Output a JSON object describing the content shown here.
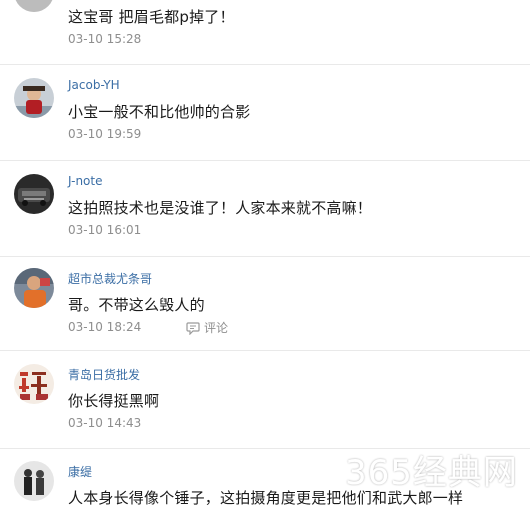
{
  "comments": [
    {
      "username": "",
      "text": "这宝哥 把眉毛都p掉了！",
      "time": "03-10 15:28"
    },
    {
      "username": "Jacob-YH",
      "text": "小宝一般不和比他帅的合影",
      "time": "03-10 19:59",
      "avatar_icon": "person-photo-avatar"
    },
    {
      "username": "J-note",
      "text": "这拍照技术也是没谁了！人家本来就不高嘛！",
      "time": "03-10 16:01",
      "avatar_icon": "car-photo-avatar"
    },
    {
      "username": "超市总裁尤条哥",
      "text": "哥。不带这么毁人的",
      "time": "03-10 18:24",
      "action_label": "评论",
      "avatar_icon": "person-orange-avatar"
    },
    {
      "username": "青岛日货批发",
      "text": "你长得挺黑啊",
      "time": "03-10 14:43",
      "avatar_icon": "calligraphy-avatar"
    },
    {
      "username": "康缇",
      "text": "人本身长得像个锤子，这拍摄角度更是把他们和武大郎一样",
      "time": "",
      "avatar_icon": "couple-photo-avatar"
    }
  ],
  "watermark": "365经典网",
  "colors": {
    "username": "#3b6ea5",
    "text": "#1a1a1a",
    "time": "#8e8e8e",
    "divider": "#e9e9e9"
  }
}
